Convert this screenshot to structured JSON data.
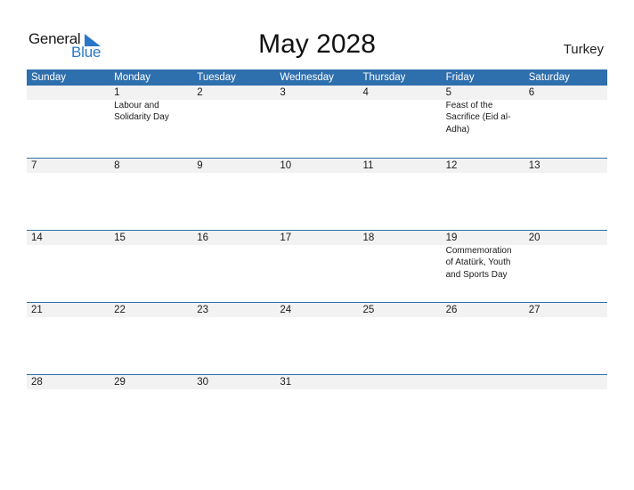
{
  "header": {
    "logo_general": "General",
    "logo_blue": "Blue",
    "title": "May 2028",
    "country": "Turkey"
  },
  "colors": {
    "header_bg": "#2e6fad",
    "logo_blue": "#2a77c9",
    "band_bg": "#f2f2f2"
  },
  "weekdays": [
    "Sunday",
    "Monday",
    "Tuesday",
    "Wednesday",
    "Thursday",
    "Friday",
    "Saturday"
  ],
  "weeks": [
    [
      {
        "day": "",
        "event": ""
      },
      {
        "day": "1",
        "event": "Labour and Solidarity Day"
      },
      {
        "day": "2",
        "event": ""
      },
      {
        "day": "3",
        "event": ""
      },
      {
        "day": "4",
        "event": ""
      },
      {
        "day": "5",
        "event": "Feast of the Sacrifice (Eid al-Adha)"
      },
      {
        "day": "6",
        "event": ""
      }
    ],
    [
      {
        "day": "7",
        "event": ""
      },
      {
        "day": "8",
        "event": ""
      },
      {
        "day": "9",
        "event": ""
      },
      {
        "day": "10",
        "event": ""
      },
      {
        "day": "11",
        "event": ""
      },
      {
        "day": "12",
        "event": ""
      },
      {
        "day": "13",
        "event": ""
      }
    ],
    [
      {
        "day": "14",
        "event": ""
      },
      {
        "day": "15",
        "event": ""
      },
      {
        "day": "16",
        "event": ""
      },
      {
        "day": "17",
        "event": ""
      },
      {
        "day": "18",
        "event": ""
      },
      {
        "day": "19",
        "event": "Commemoration of Atatürk, Youth and Sports Day"
      },
      {
        "day": "20",
        "event": ""
      }
    ],
    [
      {
        "day": "21",
        "event": ""
      },
      {
        "day": "22",
        "event": ""
      },
      {
        "day": "23",
        "event": ""
      },
      {
        "day": "24",
        "event": ""
      },
      {
        "day": "25",
        "event": ""
      },
      {
        "day": "26",
        "event": ""
      },
      {
        "day": "27",
        "event": ""
      }
    ],
    [
      {
        "day": "28",
        "event": ""
      },
      {
        "day": "29",
        "event": ""
      },
      {
        "day": "30",
        "event": ""
      },
      {
        "day": "31",
        "event": ""
      },
      {
        "day": "",
        "event": ""
      },
      {
        "day": "",
        "event": ""
      },
      {
        "day": "",
        "event": ""
      }
    ]
  ]
}
